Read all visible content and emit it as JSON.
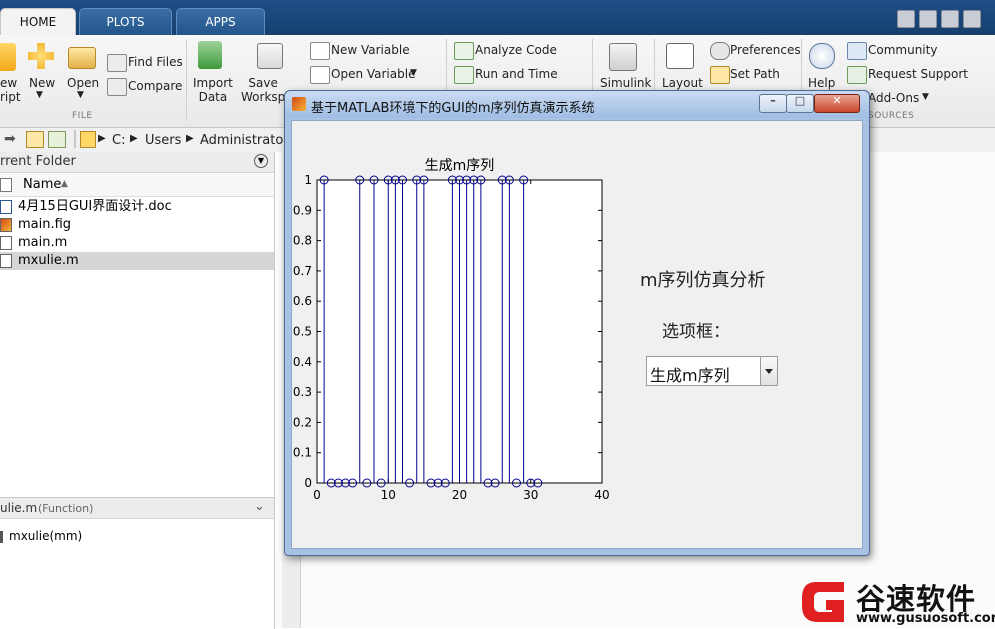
{
  "tabs": [
    {
      "label": "HOME",
      "active": true
    },
    {
      "label": "PLOTS",
      "active": false
    },
    {
      "label": "APPS",
      "active": false
    }
  ],
  "ribbon": {
    "new_script": "ew\nript",
    "new": "New",
    "open": "Open",
    "find_files": "Find Files",
    "compare": "Compare",
    "import_data": "Import\nData",
    "save_workspace": "Save\nWorksp",
    "new_variable": "New Variable",
    "open_variable": "Open Variable",
    "analyze_code": "Analyze Code",
    "run_and_time": "Run and Time",
    "simulink": "Simulink",
    "layout": "Layout",
    "preferences": "Preferences",
    "set_path": "Set Path",
    "help": "Help",
    "community": "Community",
    "request_support": "Request Support",
    "add_ons": "Add-Ons",
    "section_file": "FILE",
    "section_resources": "SOURCES"
  },
  "address": {
    "drive": "C:",
    "users": "Users",
    "administrator": "Administrator"
  },
  "left_panel": {
    "title": "rrent Folder",
    "col_name": "Name",
    "files": [
      {
        "name": "4月15日GUI界面设计.doc",
        "selected": false
      },
      {
        "name": "main.fig",
        "selected": false
      },
      {
        "name": "main.m",
        "selected": false
      },
      {
        "name": "mxulie.m",
        "selected": true
      }
    ],
    "details_title": "ulie.m",
    "details_type": "(Function)",
    "details_signature": "mxulie(mm)"
  },
  "figure": {
    "title": "基于MATLAB环境下的GUI的m序列仿真演示系统",
    "gui_title": "m序列仿真分析",
    "selector_label": "选项框：",
    "popup_value": "生成m序列"
  },
  "chart_data": {
    "type": "stem",
    "title": "生成m序列",
    "xlabel": "",
    "ylabel": "",
    "xlim": [
      0,
      40
    ],
    "ylim": [
      0,
      1
    ],
    "xticks": [
      0,
      10,
      20,
      30,
      40
    ],
    "yticks": [
      0,
      0.1,
      0.2,
      0.3,
      0.4,
      0.5,
      0.6,
      0.7,
      0.8,
      0.9,
      1
    ],
    "x": [
      1,
      2,
      3,
      4,
      5,
      6,
      7,
      8,
      9,
      10,
      11,
      12,
      13,
      14,
      15,
      16,
      17,
      18,
      19,
      20,
      21,
      22,
      23,
      24,
      25,
      26,
      27,
      28,
      29,
      30,
      31
    ],
    "values": [
      1,
      0,
      0,
      0,
      0,
      1,
      0,
      1,
      0,
      1,
      1,
      1,
      0,
      1,
      1,
      0,
      0,
      0,
      1,
      1,
      1,
      1,
      1,
      0,
      0,
      1,
      1,
      0,
      1,
      0,
      0
    ],
    "marker": "circle",
    "color": "#00008b"
  },
  "watermark": {
    "name": "谷速软件",
    "url": "www.gusuosoft.com",
    "color": "#e02020"
  }
}
